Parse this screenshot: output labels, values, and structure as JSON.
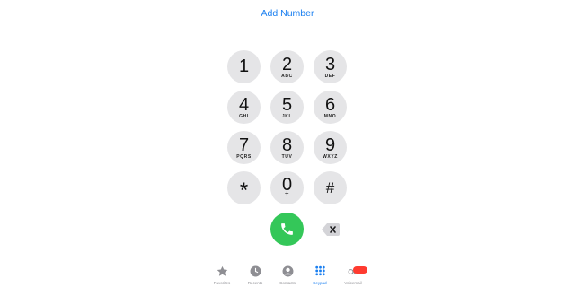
{
  "header": {
    "add_number_label": "Add Number"
  },
  "keypad": {
    "keys": [
      {
        "digit": "1",
        "letters": ""
      },
      {
        "digit": "2",
        "letters": "ABC"
      },
      {
        "digit": "3",
        "letters": "DEF"
      },
      {
        "digit": "4",
        "letters": "GHI"
      },
      {
        "digit": "5",
        "letters": "JKL"
      },
      {
        "digit": "6",
        "letters": "MNO"
      },
      {
        "digit": "7",
        "letters": "PQRS"
      },
      {
        "digit": "8",
        "letters": "TUV"
      },
      {
        "digit": "9",
        "letters": "WXYZ"
      },
      {
        "digit": "*",
        "letters": ""
      },
      {
        "digit": "0",
        "letters": "+"
      },
      {
        "digit": "#",
        "letters": ""
      }
    ]
  },
  "actions": {
    "call_icon": "phone-icon",
    "delete_icon": "backspace-icon",
    "call_color": "#34c759"
  },
  "tabbar": {
    "tabs": [
      {
        "label": "Favorites",
        "icon": "star-icon",
        "active": false
      },
      {
        "label": "Recents",
        "icon": "clock-icon",
        "active": false
      },
      {
        "label": "Contacts",
        "icon": "person-icon",
        "active": false
      },
      {
        "label": "Keypad",
        "icon": "keypad-icon",
        "active": true
      },
      {
        "label": "Voicemail",
        "icon": "voicemail-icon",
        "active": false
      }
    ],
    "voicemail_badge": ""
  },
  "colors": {
    "accent": "#1a7ff0",
    "key_background": "#e5e5e7",
    "badge": "#ff3b30"
  }
}
